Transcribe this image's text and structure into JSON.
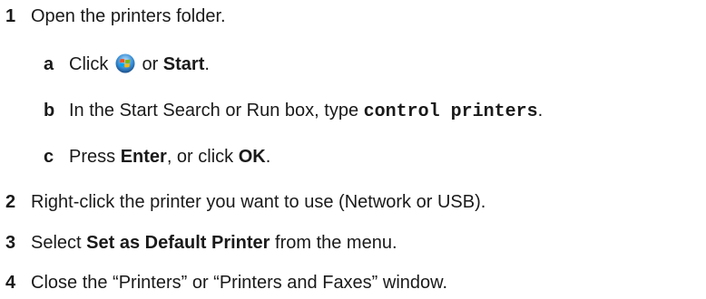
{
  "steps": [
    {
      "num": "1",
      "text": "Open the printers folder."
    },
    {
      "num": "2",
      "text": "Right-click the printer you want to use (Network or USB)."
    },
    {
      "num": "3",
      "pre": "Select ",
      "bold": "Set as Default Printer",
      "post": " from the menu."
    },
    {
      "num": "4",
      "text": "Close the “Printers” or “Printers and Faxes” window."
    }
  ],
  "substeps": {
    "a": {
      "letter": "a",
      "pre": "Click ",
      "mid": " or ",
      "bold": "Start",
      "post": "."
    },
    "b": {
      "letter": "b",
      "pre": "In the Start Search or Run box, type ",
      "code": "control printers",
      "post": "."
    },
    "c": {
      "letter": "c",
      "pre": "Press ",
      "bold1": "Enter",
      "mid": ", or click ",
      "bold2": "OK",
      "post": "."
    }
  },
  "icons": {
    "start_button": "windows-start-orb-icon"
  }
}
